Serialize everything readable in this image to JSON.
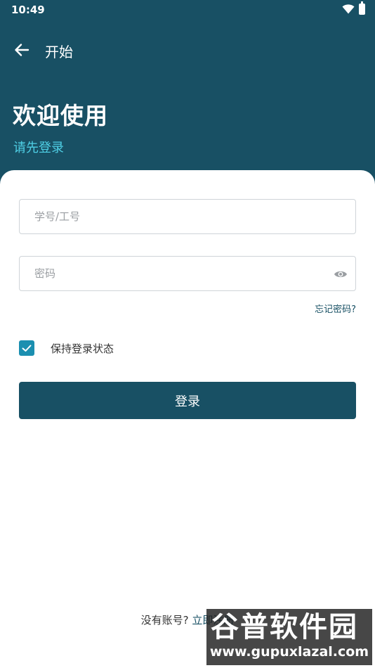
{
  "status_bar": {
    "time": "10:49",
    "icons": [
      "wifi-icon",
      "battery-charging-icon"
    ]
  },
  "toolbar": {
    "back_icon": "arrow-left-icon",
    "title": "开始"
  },
  "welcome": {
    "title": "欢迎使用",
    "subtitle": "请先登录"
  },
  "form": {
    "account_placeholder": "学号/工号",
    "account_value": "",
    "password_placeholder": "密码",
    "password_value": "",
    "password_visibility_icon": "eye-icon",
    "forgot_password": "忘记密码?",
    "remember_label": "保持登录状态",
    "remember_checked": true,
    "login_label": "登录"
  },
  "register": {
    "prompt": "没有账号?",
    "link": "立即注册"
  },
  "watermark": {
    "logo": "谷普软件园",
    "url": "www.gupuxlazal.com"
  },
  "colors": {
    "header_bg": "#185064",
    "subtitle": "#4fd0e6",
    "checkbox": "#1b8fb0",
    "button_bg": "#185064",
    "link": "#185064"
  }
}
